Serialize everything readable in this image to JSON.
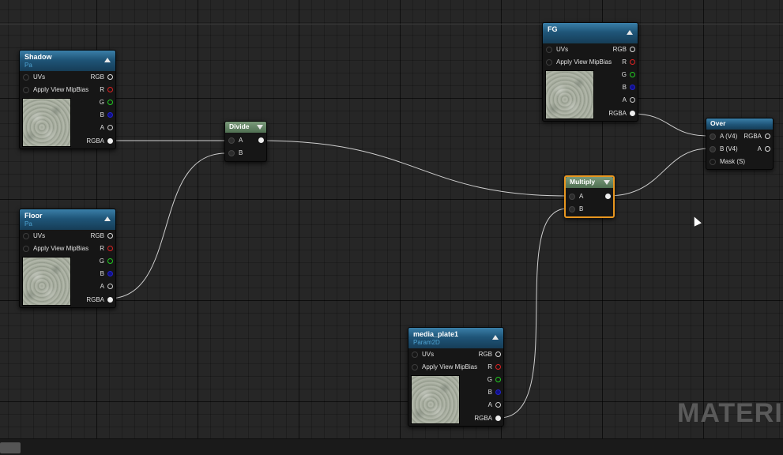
{
  "graph": {
    "nodes": {
      "shadow": {
        "title": "Shadow",
        "subtitle": "Pa",
        "inputs": [
          "UVs",
          "Apply View MipBias"
        ],
        "outputs": [
          "RGB",
          "R",
          "G",
          "B",
          "A",
          "RGBA"
        ]
      },
      "floor": {
        "title": "Floor",
        "subtitle": "Pa",
        "inputs": [
          "UVs",
          "Apply View MipBias"
        ],
        "outputs": [
          "RGB",
          "R",
          "G",
          "B",
          "A",
          "RGBA"
        ]
      },
      "fg": {
        "title": "FG",
        "subtitle": "",
        "inputs": [
          "UVs",
          "Apply View MipBias"
        ],
        "outputs": [
          "RGB",
          "R",
          "G",
          "B",
          "A",
          "RGBA"
        ]
      },
      "media_plate": {
        "title": "media_plate1",
        "subtitle": "Param2D",
        "inputs": [
          "UVs",
          "Apply View MipBias"
        ],
        "outputs": [
          "RGB",
          "R",
          "G",
          "B",
          "A",
          "RGBA"
        ]
      },
      "divide": {
        "title": "Divide",
        "inputs": [
          "A",
          "B"
        ]
      },
      "multiply": {
        "title": "Multiply",
        "inputs": [
          "A",
          "B"
        ]
      },
      "over": {
        "title": "Over",
        "inputs": [
          "A (V4)",
          "B (V4)",
          "Mask (S)"
        ],
        "outputs": [
          "RGBA",
          "A"
        ]
      }
    }
  },
  "watermark": "MATERIA",
  "colors": {
    "background": "#262626",
    "texture_header": "#1f5578",
    "math_header": "#5f7f62",
    "selection": "#e8961f",
    "pin_r": "#dd2222",
    "pin_g": "#22cc22",
    "pin_b": "#2222cc"
  }
}
